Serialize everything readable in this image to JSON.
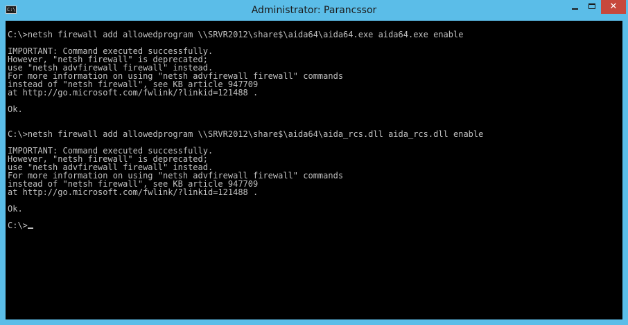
{
  "window": {
    "title": "Administrator: Parancssor",
    "icon": "console-icon",
    "icon_label": "C:\\",
    "buttons": {
      "minimize": "minimize-icon",
      "maximize": "maximize-icon",
      "close": "close-icon",
      "close_glyph": "✕"
    }
  },
  "colors": {
    "titlebar": "#5bbde8",
    "close_button": "#c7483c",
    "console_background": "#000000",
    "console_text": "#c0c0c0"
  },
  "console": {
    "lines": [
      "",
      "C:\\>netsh firewall add allowedprogram \\\\SRVR2012\\share$\\aida64\\aida64.exe aida64.exe enable",
      "",
      "IMPORTANT: Command executed successfully.",
      "However, \"netsh firewall\" is deprecated;",
      "use \"netsh advfirewall firewall\" instead.",
      "For more information on using \"netsh advfirewall firewall\" commands",
      "instead of \"netsh firewall\", see KB article 947709",
      "at http://go.microsoft.com/fwlink/?linkid=121488 .",
      "",
      "Ok.",
      "",
      "",
      "C:\\>netsh firewall add allowedprogram \\\\SRVR2012\\share$\\aida64\\aida_rcs.dll aida_rcs.dll enable",
      "",
      "IMPORTANT: Command executed successfully.",
      "However, \"netsh firewall\" is deprecated;",
      "use \"netsh advfirewall firewall\" instead.",
      "For more information on using \"netsh advfirewall firewall\" commands",
      "instead of \"netsh firewall\", see KB article 947709",
      "at http://go.microsoft.com/fwlink/?linkid=121488 .",
      "",
      "Ok.",
      "",
      "C:\\>"
    ]
  }
}
